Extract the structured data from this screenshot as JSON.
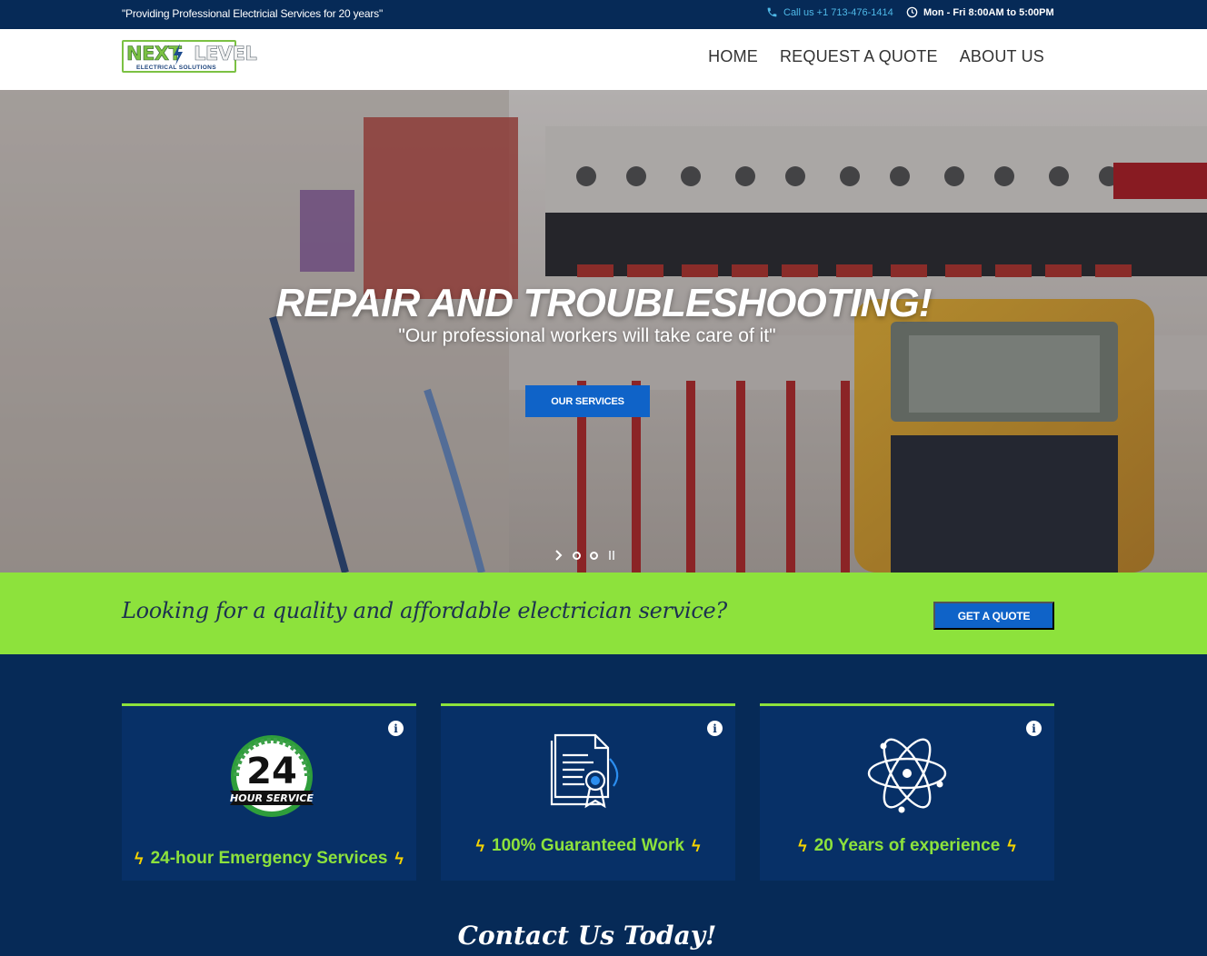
{
  "topbar": {
    "tagline": "\"Providing Professional Electricial Services for 20 years\"",
    "phone": "Call us +1 713-476-1414",
    "hours": "Mon - Fri 8:00AM to 5:00PM"
  },
  "header": {
    "logo_main": "NEXT",
    "logo_level": "LEVEL",
    "logo_sub": "ELECTRICAL SOLUTIONS",
    "nav": [
      "HOME",
      "REQUEST A QUOTE",
      "ABOUT US"
    ]
  },
  "hero": {
    "title": "REPAIR AND TROUBLESHOOTING!",
    "subtitle": "\"Our professional workers will take care of it\"",
    "button": "OUR SERVICES",
    "slides_count": 2
  },
  "banner": {
    "question": "Looking for a quality and affordable electrician service?",
    "button": "GET A QUOTE"
  },
  "features": [
    {
      "icon": "24-hour-service-icon",
      "title": "24-hour Emergency Services",
      "badge_number": "24",
      "badge_text": "HOUR SERVICE"
    },
    {
      "icon": "certificate-document-icon",
      "title": "100% Guaranteed Work"
    },
    {
      "icon": "atom-icon",
      "title": "20 Years of experience"
    }
  ],
  "contact_heading": "Contact Us Today!",
  "colors": {
    "navy": "#062a57",
    "green": "#8de23c",
    "blue_button": "#0f63c8",
    "phone_blue": "#4fb9e8"
  }
}
